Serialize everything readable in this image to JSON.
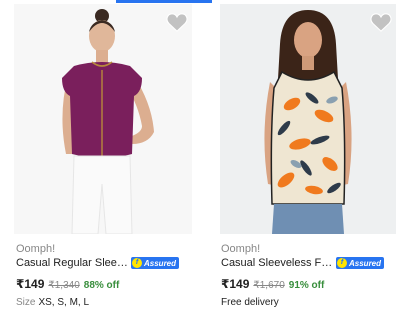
{
  "colors": {
    "accent": "#2874f0",
    "discount": "#388e3c",
    "muted": "#878787",
    "assured_icon": "#ffe500"
  },
  "products": [
    {
      "brand": "Oomph!",
      "title": "Casual Regular Sleeves Solid Wo...",
      "assured_label": "Assured",
      "price": "₹149",
      "mrp": "₹1,340",
      "discount": "88% off",
      "extra_label": "Size",
      "extra_value": "XS, S, M, L",
      "wishlist_icon": "heart-icon",
      "image_desc_icon": "purple-top-photo"
    },
    {
      "brand": "Oomph!",
      "title": "Casual Sleeveless Floral Print Wo...",
      "assured_label": "Assured",
      "price": "₹149",
      "mrp": "₹1,670",
      "discount": "91% off",
      "extra_label": "",
      "extra_value": "Free delivery",
      "wishlist_icon": "heart-icon",
      "image_desc_icon": "floral-top-photo"
    }
  ]
}
